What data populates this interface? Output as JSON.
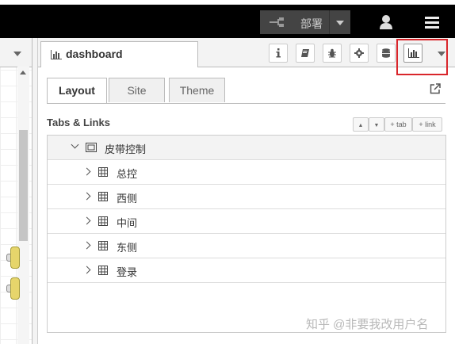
{
  "header": {
    "deploy_label": "部署",
    "user_icon": "user-icon",
    "menu_icon": "hamburger-menu-icon"
  },
  "sidebar": {
    "active_tab": "dashboard",
    "toolbar_icons": [
      "info-icon",
      "book-icon",
      "bug-icon",
      "gear-icon",
      "database-icon",
      "bar-chart-icon"
    ],
    "subtabs": [
      "Layout",
      "Site",
      "Theme"
    ],
    "selected_subtab": "Layout",
    "section_title": "Tabs & Links",
    "mini_buttons": {
      "up": "▲",
      "down": "▼",
      "tab": "+ tab",
      "link": "+ link"
    },
    "tree": {
      "group_label": "皮带控制",
      "items": [
        "总控",
        "西侧",
        "中间",
        "东侧",
        "登录"
      ]
    }
  },
  "watermark": "知乎 @非要我改用户名",
  "colors": {
    "highlight": "#d9262b",
    "header_bg": "#000000"
  }
}
